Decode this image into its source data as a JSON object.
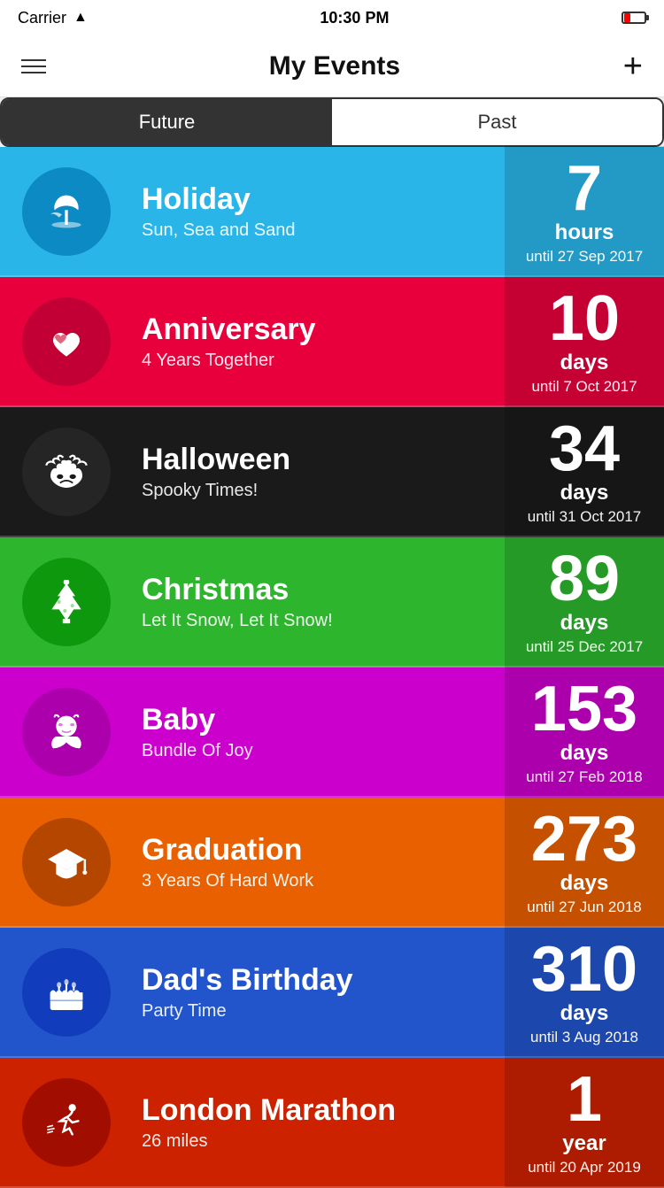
{
  "statusBar": {
    "carrier": "Carrier",
    "time": "10:30 PM"
  },
  "navBar": {
    "title": "My Events",
    "addLabel": "+"
  },
  "segmentControl": {
    "options": [
      "Future",
      "Past"
    ],
    "active": "Future"
  },
  "events": [
    {
      "id": "holiday",
      "name": "Holiday",
      "subtitle": "Sun, Sea and Sand",
      "countdownNumber": "7",
      "countdownUnit": "hours",
      "countdownDate": "until 27 Sep 2017",
      "icon": "🌴",
      "colorClass": "card-holiday",
      "iconClass": "icon-circle-holiday"
    },
    {
      "id": "anniversary",
      "name": "Anniversary",
      "subtitle": "4 Years Together",
      "countdownNumber": "10",
      "countdownUnit": "days",
      "countdownDate": "until 7 Oct 2017",
      "icon": "💕",
      "colorClass": "card-anniversary",
      "iconClass": "icon-circle-anniversary"
    },
    {
      "id": "halloween",
      "name": "Halloween",
      "subtitle": "Spooky Times!",
      "countdownNumber": "34",
      "countdownUnit": "days",
      "countdownDate": "until 31 Oct 2017",
      "icon": "🦇",
      "colorClass": "card-halloween",
      "iconClass": "icon-circle-halloween"
    },
    {
      "id": "christmas",
      "name": "Christmas",
      "subtitle": "Let It Snow, Let It Snow!",
      "countdownNumber": "89",
      "countdownUnit": "days",
      "countdownDate": "until 25 Dec 2017",
      "icon": "🎄",
      "colorClass": "card-christmas",
      "iconClass": "icon-circle-christmas"
    },
    {
      "id": "baby",
      "name": "Baby",
      "subtitle": "Bundle Of Joy",
      "countdownNumber": "153",
      "countdownUnit": "days",
      "countdownDate": "until 27 Feb 2018",
      "icon": "👶",
      "colorClass": "card-baby",
      "iconClass": "icon-circle-baby"
    },
    {
      "id": "graduation",
      "name": "Graduation",
      "subtitle": "3 Years Of Hard Work",
      "countdownNumber": "273",
      "countdownUnit": "days",
      "countdownDate": "until 27 Jun 2018",
      "icon": "🎓",
      "colorClass": "card-graduation",
      "iconClass": "icon-circle-graduation"
    },
    {
      "id": "birthday",
      "name": "Dad's Birthday",
      "subtitle": "Party Time",
      "countdownNumber": "310",
      "countdownUnit": "days",
      "countdownDate": "until 3 Aug 2018",
      "icon": "🎂",
      "colorClass": "card-birthday",
      "iconClass": "icon-circle-birthday"
    },
    {
      "id": "marathon",
      "name": "London Marathon",
      "subtitle": "26 miles",
      "countdownNumber": "1",
      "countdownUnit": "year",
      "countdownDate": "until 20 Apr 2019",
      "icon": "🏃",
      "colorClass": "card-marathon",
      "iconClass": "icon-circle-marathon"
    }
  ]
}
